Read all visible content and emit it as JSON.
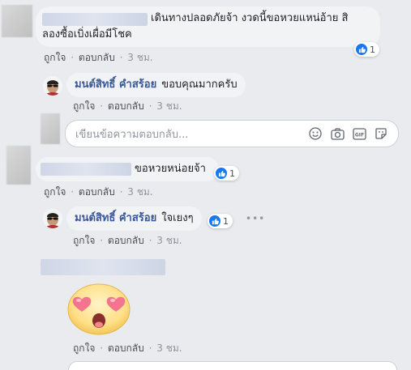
{
  "comments": [
    {
      "text_line1": "เดินทางปลอดภัยจ้า งวดนี้ขอหวยแหน่อ้าย สิ",
      "text_line2": "ลองซื้อเบิ่งเผื่อมีโชค",
      "like": "ถูกใจ",
      "reply": "ตอบกลับ",
      "time": "3 ชม.",
      "reaction_count": "1"
    },
    {
      "text": "ขอหวยหน่อยจ้า",
      "like": "ถูกใจ",
      "reply": "ตอบกลับ",
      "time": "3 ชม.",
      "reaction_count": "1"
    },
    {
      "like": "ถูกใจ",
      "reply": "ตอบกลับ",
      "time": "3 ชม."
    }
  ],
  "replies": [
    {
      "author": "มนต์สิทธิ์ คำสร้อย",
      "text": "ขอบคุณมากครับ",
      "like": "ถูกใจ",
      "reply": "ตอบกลับ",
      "time": "3 ชม."
    },
    {
      "author": "มนต์สิทธิ์ คำสร้อย",
      "text": "ใจเยงๆ",
      "like": "ถูกใจ",
      "reply": "ตอบกลับ",
      "time": "3 ชม.",
      "reaction_count": "1"
    }
  ],
  "reply_input": {
    "placeholder": "เขียนข้อความตอบกลับ..."
  },
  "separator": "·",
  "sticker": "heart-eyes-emoji",
  "colors": {
    "background": "#e9ebee",
    "bubble": "#f2f3f5",
    "name": "#385898",
    "like_blue": "#1877f2"
  }
}
